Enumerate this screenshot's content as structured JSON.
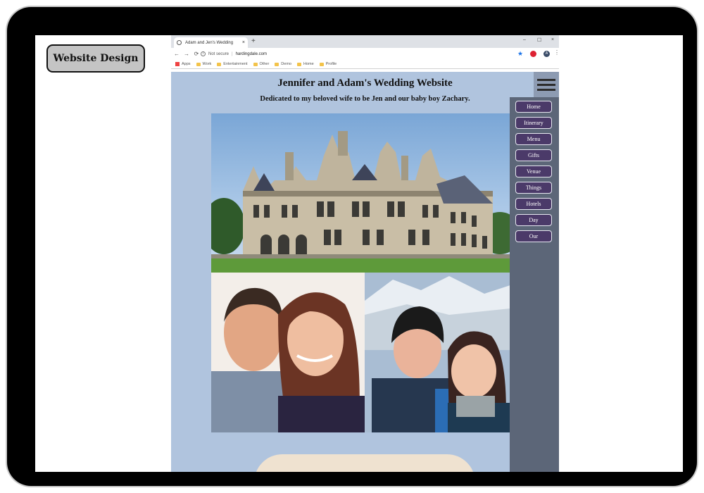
{
  "label": "Website Design",
  "browser": {
    "tab_title": "Adam and Jen's Wedding",
    "new_tab": "+",
    "tab_close": "×",
    "window_controls": [
      "–",
      "☐",
      "×"
    ],
    "security": "Not secure",
    "url": "hardingdale.com",
    "bookmarks": [
      "Apps",
      "Work",
      "Entertainment",
      "Other",
      "Demo",
      "Home",
      "Profile"
    ],
    "account_initial": "A"
  },
  "site": {
    "title": "Jennifer and Adam's Wedding Website",
    "subtitle": "Dedicated to my beloved wife to be Jen and our baby boy Zachary.",
    "nav": [
      "Home",
      "Itinerary",
      "Menu",
      "Gifts",
      "Venue",
      "Things",
      "Hotels",
      "Day",
      "Our"
    ]
  },
  "colors": {
    "page_bg": "#b0c4de",
    "sidenav_bg": "#5c6678",
    "nav_button": "#4b3a69"
  }
}
